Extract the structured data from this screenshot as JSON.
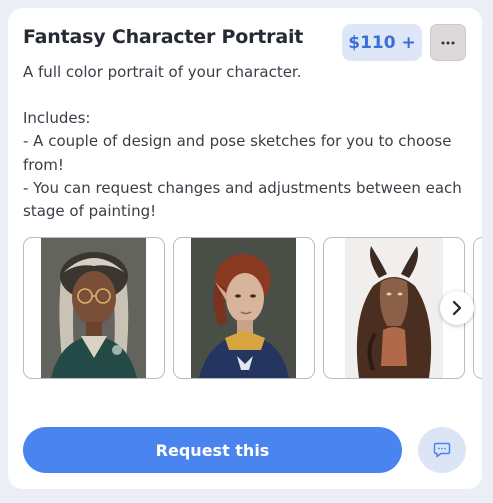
{
  "listing": {
    "title": "Fantasy Character Portrait",
    "price": "$110 +",
    "description": {
      "intro": "A full color portrait of your character.",
      "includes_heading": "Includes:",
      "items": [
        "- A couple of design and pose sketches for you to choose from!",
        "- You can request changes and adjustments between each stage of painting!"
      ]
    }
  },
  "gallery": {
    "images": [
      "portrait-woman-glasses-braids",
      "portrait-elf-red-hair",
      "portrait-horned-dragon-figure"
    ],
    "dot_count": 4,
    "active_dot": 1
  },
  "actions": {
    "request_label": "Request this"
  },
  "colors": {
    "accent": "#4a84ee",
    "price_bg": "#dde7f8",
    "price_text": "#3b6fd8",
    "page_bg": "#ebeef4"
  },
  "icons": {
    "more": "more-horizontal-icon",
    "next": "chevron-right-icon",
    "chat": "chat-bubble-icon"
  }
}
